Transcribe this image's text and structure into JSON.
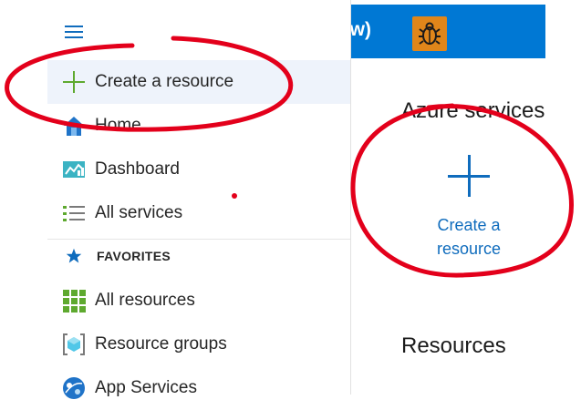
{
  "topbar": {
    "title_fragment": "ew)"
  },
  "main": {
    "services_heading": "Azure services",
    "create_resource_line1": "Create a",
    "create_resource_line2": "resource",
    "resources_heading": "Resources"
  },
  "sidebar": {
    "favorites_title": "FAVORITES",
    "items": [
      {
        "label": "Create a resource",
        "icon": "plus-icon"
      },
      {
        "label": "Home",
        "icon": "home-icon"
      },
      {
        "label": "Dashboard",
        "icon": "dashboard-icon"
      },
      {
        "label": "All services",
        "icon": "list-icon"
      },
      {
        "label": "All resources",
        "icon": "grid-icon"
      },
      {
        "label": "Resource groups",
        "icon": "resource-group-icon"
      },
      {
        "label": "App Services",
        "icon": "app-services-icon"
      }
    ]
  },
  "colors": {
    "brand_blue": "#0078d4",
    "link_blue": "#0f6cbd",
    "annotation_red": "#e3001b",
    "bug_button": "#e0861a"
  }
}
